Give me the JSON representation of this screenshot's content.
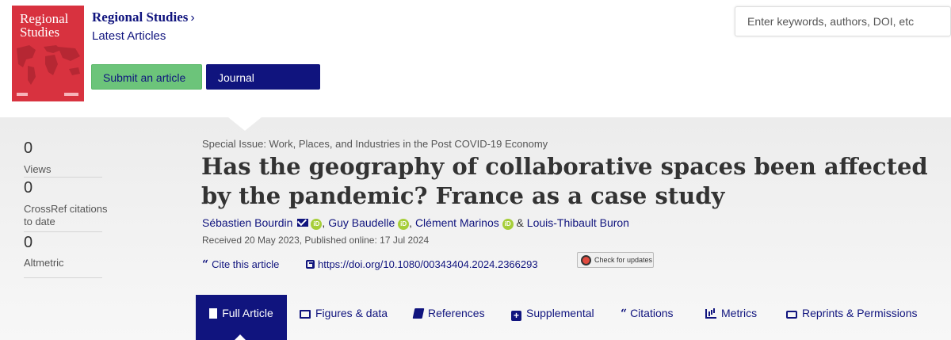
{
  "journal": {
    "cover_title_line1": "Regional",
    "cover_title_line2": "Studies",
    "name": "Regional Studies",
    "chevron": "›",
    "subtitle": "Latest Articles",
    "submit_label": "Submit an article",
    "homepage_label": "Journal homepage"
  },
  "search": {
    "placeholder": "Enter keywords, authors, DOI, etc"
  },
  "metrics": {
    "views_count": "0",
    "views_label": "Views",
    "crossref_count": "0",
    "crossref_label": "CrossRef citations to date",
    "altmetric_count": "0",
    "altmetric_label": "Altmetric"
  },
  "article": {
    "special_issue": "Special Issue: Work, Places, and Industries in the Post COVID-19 Economy",
    "title": "Has the geography of collaborative spaces been affected by the pandemic? France as a case study",
    "authors": [
      {
        "name": "Sébastien Bourdin",
        "email": true,
        "orcid": true
      },
      {
        "name": "Guy Baudelle",
        "orcid": true
      },
      {
        "name": "Clément Marinos",
        "orcid": true
      },
      {
        "name": "Louis-Thibault Buron",
        "orcid": false
      }
    ],
    "dates": "Received 20 May 2023, Published online: 17 Jul 2024",
    "cite_label": "Cite this article",
    "doi_link": "https://doi.org/10.1080/00343404.2024.2366293",
    "check_updates_label": "Check for updates"
  },
  "tabs": [
    {
      "label": "Full Article",
      "icon": "document-icon",
      "active": true
    },
    {
      "label": "Figures & data",
      "icon": "image-icon"
    },
    {
      "label": "References",
      "icon": "book-icon"
    },
    {
      "label": "Supplemental",
      "icon": "plus-square-icon"
    },
    {
      "label": "Citations",
      "icon": "quote-icon"
    },
    {
      "label": "Metrics",
      "icon": "bar-chart-icon"
    },
    {
      "label": "Reprints & Permissions",
      "icon": "print-icon"
    }
  ],
  "colors": {
    "brand_navy": "#10147e",
    "submit_green": "#6cc47a",
    "cover_red": "#d8323f",
    "orcid_green": "#a6ce39"
  }
}
